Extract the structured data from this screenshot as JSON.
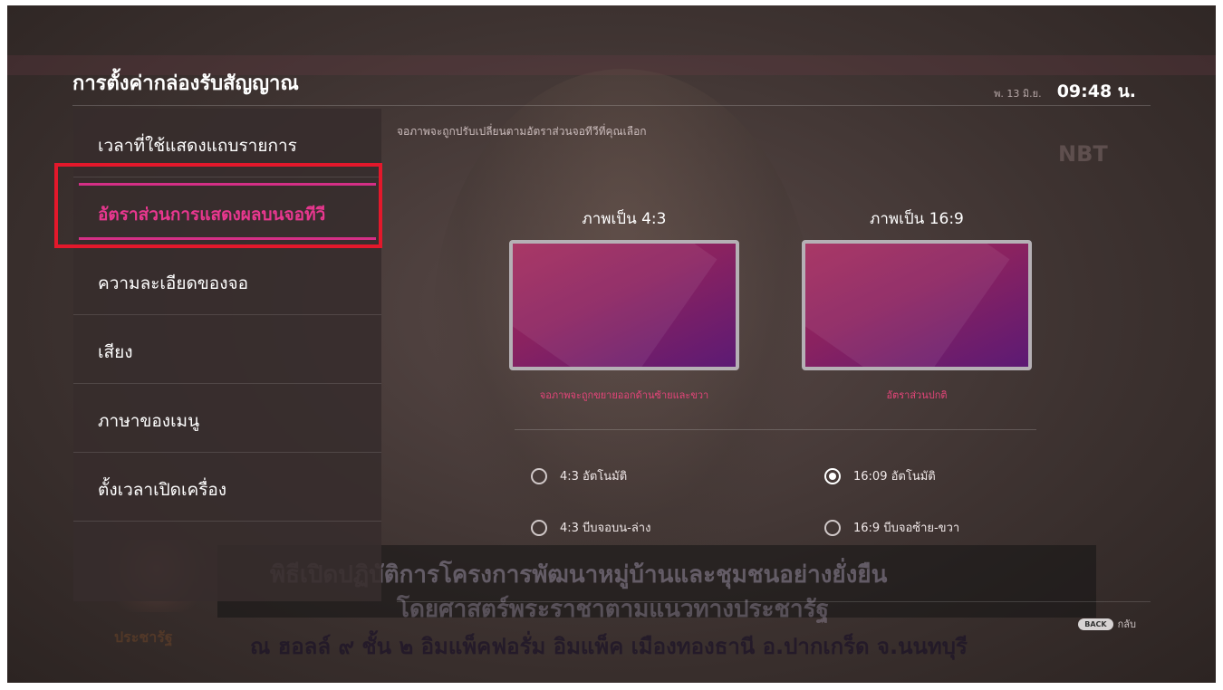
{
  "header": {
    "title": "การตั้งค่ากล่องรับสัญญาณ",
    "date": "พ. 13 มิ.ย.",
    "time": "09:48 น."
  },
  "sidebar": {
    "items": [
      {
        "label": "เวลาที่ใช้แสดงแถบรายการ"
      },
      {
        "label": "อัตราส่วนการแสดงผลบนจอทีวี"
      },
      {
        "label": "ความละเอียดของจอ"
      },
      {
        "label": "เสียง"
      },
      {
        "label": "ภาษาของเมนู"
      },
      {
        "label": "ตั้งเวลาเปิดเครื่อง"
      }
    ],
    "active_index": 1
  },
  "content": {
    "description": "จอภาพจะถูกปรับเปลี่ยนตามอัตราส่วนจอทีวีที่คุณเลือก",
    "options": [
      {
        "title": "ภาพเป็น 4:3",
        "caption": "จอภาพจะถูกขยายออกด้านซ้ายและขวา"
      },
      {
        "title": "ภาพเป็น 16:9",
        "caption": "อัตราส่วนปกติ"
      }
    ],
    "radios": [
      {
        "label": "4:3 อัตโนมัติ",
        "selected": false
      },
      {
        "label": "16:09 อัตโนมัติ",
        "selected": true
      },
      {
        "label": "4:3 บีบจอบน-ล่าง",
        "selected": false
      },
      {
        "label": "16:9 บีบจอซ้าย-ขวา",
        "selected": false
      }
    ]
  },
  "footer": {
    "back_icon": "BACK",
    "back_label": "กลับ"
  },
  "background": {
    "banner_line1": "พิธีเปิดปฏิบัติการโครงการพัฒนาหมู่บ้านและชุมชนอย่างยั่งยืน",
    "banner_line2": "โดยศาสตร์พระราชาตามแนวทางประชารัฐ",
    "bottom_line": "ณ ฮอลล์ ๙ ชั้น ๒ อิมแพ็คฟอรั่ม อิมแพ็ค เมืองทองธานี อ.ปากเกร็ด จ.นนทบุรี",
    "logo_text": "ประชารัฐ",
    "channel_logo": "NBT"
  },
  "colors": {
    "accent": "#e8378f",
    "highlight_box": "#e3182b",
    "tv_gradient_start": "#a3295b",
    "tv_gradient_end": "#5c1a74"
  }
}
